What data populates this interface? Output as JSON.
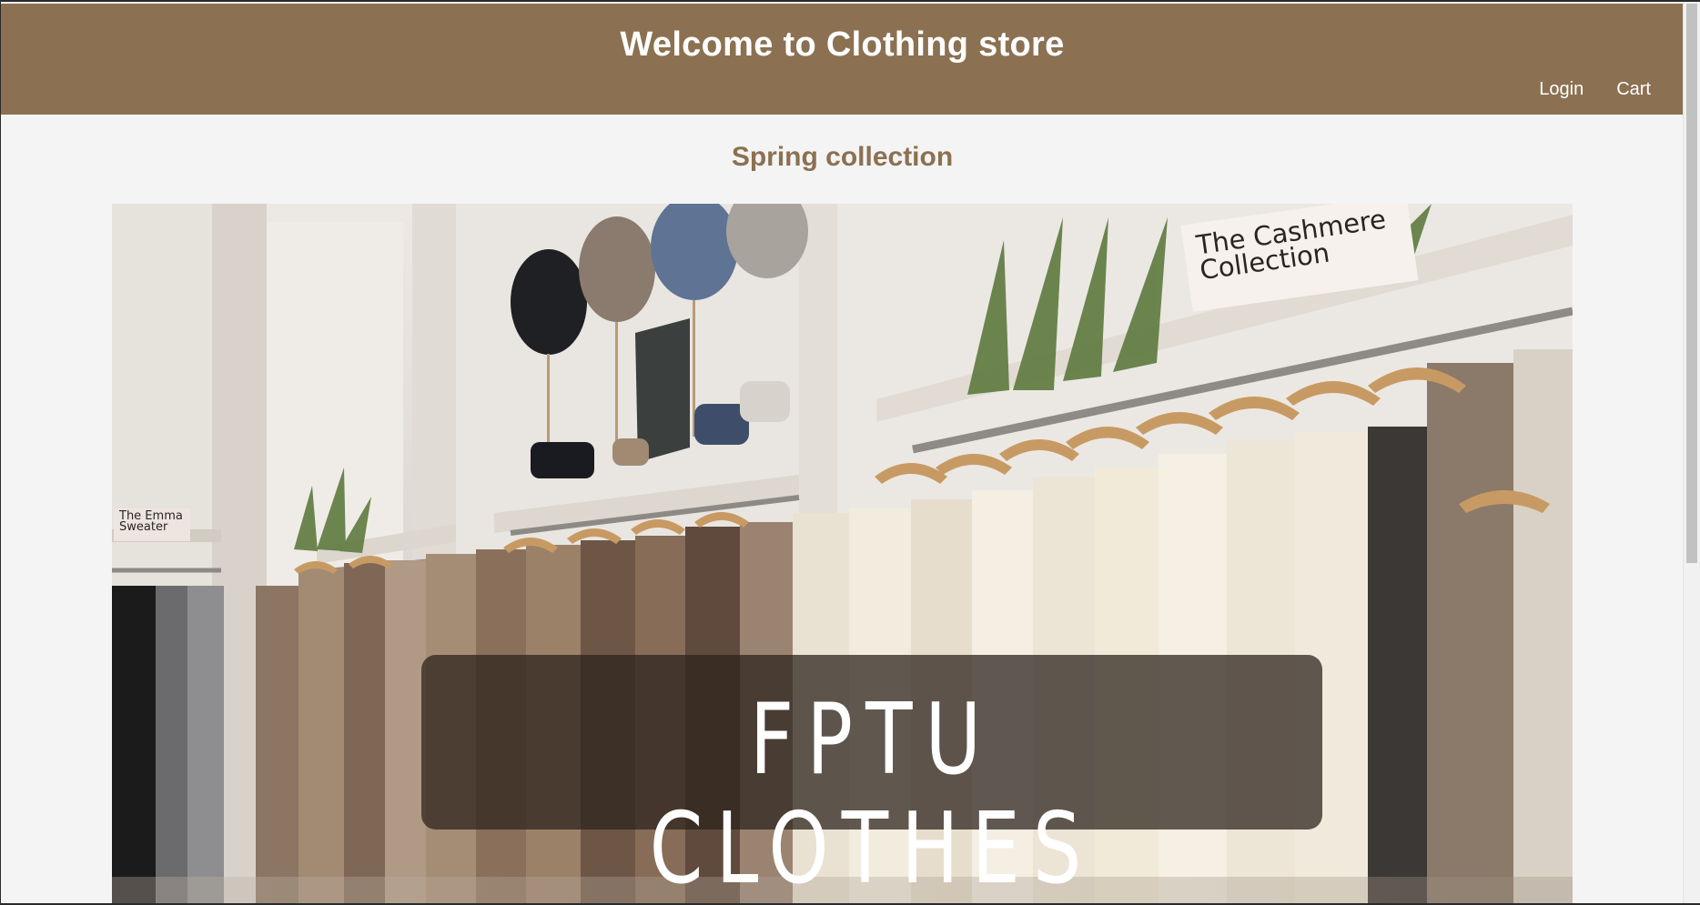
{
  "header": {
    "title": "Welcome to Clothing store",
    "nav": {
      "login": "Login",
      "cart": "Cart"
    }
  },
  "main": {
    "section_title": "Spring collection",
    "hero": {
      "banner_text": "FPTU CLOTHES",
      "sign_cashmere": "The Cashmere Collection",
      "sign_emma": "The Emma Sweater"
    }
  },
  "colors": {
    "header_bg": "#8b7152",
    "accent_text": "#8b7152",
    "page_bg": "#f4f4f4"
  }
}
